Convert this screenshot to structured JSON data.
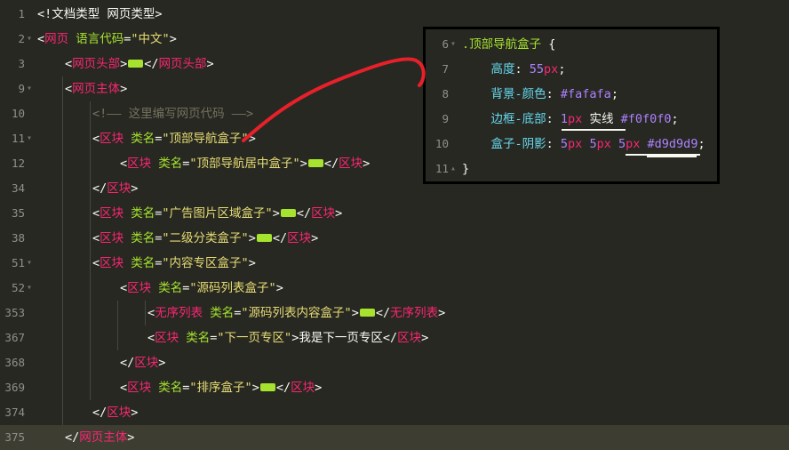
{
  "editor": {
    "lines": [
      {
        "num": "1",
        "fold": "",
        "indent": 0,
        "cur": false,
        "tokens": [
          [
            "p",
            "<!"
          ],
          [
            "p",
            "文档类型 网页类型"
          ],
          [
            "p",
            ">"
          ]
        ]
      },
      {
        "num": "2",
        "fold": "▾",
        "indent": 0,
        "cur": false,
        "tokens": [
          [
            "p",
            "<"
          ],
          [
            "t",
            "网页"
          ],
          [
            "p",
            " "
          ],
          [
            "a",
            "语言代码"
          ],
          [
            "p",
            "="
          ],
          [
            "s",
            "\"中文\""
          ],
          [
            "p",
            ">"
          ]
        ]
      },
      {
        "num": "3",
        "fold": "",
        "indent": 1,
        "cur": false,
        "tokens": [
          [
            "p",
            "<"
          ],
          [
            "t",
            "网页头部"
          ],
          [
            "p",
            ">"
          ],
          [
            "icon",
            "ellipsis-icon"
          ],
          [
            "p",
            "</"
          ],
          [
            "t",
            "网页头部"
          ],
          [
            "p",
            ">"
          ]
        ]
      },
      {
        "num": "9",
        "fold": "▾",
        "indent": 1,
        "cur": false,
        "tokens": [
          [
            "p",
            "<"
          ],
          [
            "t",
            "网页主体"
          ],
          [
            "p",
            ">"
          ]
        ]
      },
      {
        "num": "10",
        "fold": "",
        "indent": 2,
        "cur": false,
        "tokens": [
          [
            "c",
            "<!—— 这里编写网页代码 ——>"
          ]
        ]
      },
      {
        "num": "11",
        "fold": "▾",
        "indent": 2,
        "cur": false,
        "tokens": [
          [
            "p",
            "<"
          ],
          [
            "t",
            "区块"
          ],
          [
            "p",
            " "
          ],
          [
            "a",
            "类名"
          ],
          [
            "p",
            "="
          ],
          [
            "s",
            "\"顶部导航盒子\""
          ],
          [
            "p",
            ">"
          ]
        ]
      },
      {
        "num": "12",
        "fold": "",
        "indent": 3,
        "cur": false,
        "tokens": [
          [
            "p",
            "<"
          ],
          [
            "t",
            "区块"
          ],
          [
            "p",
            " "
          ],
          [
            "a",
            "类名"
          ],
          [
            "p",
            "="
          ],
          [
            "s",
            "\"顶部导航居中盒子\""
          ],
          [
            "p",
            ">"
          ],
          [
            "icon",
            "ellipsis-icon"
          ],
          [
            "p",
            "</"
          ],
          [
            "t",
            "区块"
          ],
          [
            "p",
            ">"
          ]
        ]
      },
      {
        "num": "34",
        "fold": "",
        "indent": 2,
        "cur": false,
        "tokens": [
          [
            "p",
            "</"
          ],
          [
            "t",
            "区块"
          ],
          [
            "p",
            ">"
          ]
        ]
      },
      {
        "num": "35",
        "fold": "",
        "indent": 2,
        "cur": false,
        "tokens": [
          [
            "p",
            "<"
          ],
          [
            "t",
            "区块"
          ],
          [
            "p",
            " "
          ],
          [
            "a",
            "类名"
          ],
          [
            "p",
            "="
          ],
          [
            "s",
            "\"广告图片区域盒子\""
          ],
          [
            "p",
            ">"
          ],
          [
            "icon",
            "ellipsis-icon"
          ],
          [
            "p",
            "</"
          ],
          [
            "t",
            "区块"
          ],
          [
            "p",
            ">"
          ]
        ]
      },
      {
        "num": "38",
        "fold": "",
        "indent": 2,
        "cur": false,
        "tokens": [
          [
            "p",
            "<"
          ],
          [
            "t",
            "区块"
          ],
          [
            "p",
            " "
          ],
          [
            "a",
            "类名"
          ],
          [
            "p",
            "="
          ],
          [
            "s",
            "\"二级分类盒子\""
          ],
          [
            "p",
            ">"
          ],
          [
            "icon",
            "ellipsis-icon"
          ],
          [
            "p",
            "</"
          ],
          [
            "t",
            "区块"
          ],
          [
            "p",
            ">"
          ]
        ]
      },
      {
        "num": "51",
        "fold": "▾",
        "indent": 2,
        "cur": false,
        "tokens": [
          [
            "p",
            "<"
          ],
          [
            "t",
            "区块"
          ],
          [
            "p",
            " "
          ],
          [
            "a",
            "类名"
          ],
          [
            "p",
            "="
          ],
          [
            "s",
            "\"内容专区盒子\""
          ],
          [
            "p",
            ">"
          ]
        ]
      },
      {
        "num": "52",
        "fold": "▾",
        "indent": 3,
        "cur": false,
        "tokens": [
          [
            "p",
            "<"
          ],
          [
            "t",
            "区块"
          ],
          [
            "p",
            " "
          ],
          [
            "a",
            "类名"
          ],
          [
            "p",
            "="
          ],
          [
            "s",
            "\"源码列表盒子\""
          ],
          [
            "p",
            ">"
          ]
        ]
      },
      {
        "num": "353",
        "fold": "",
        "indent": 4,
        "cur": false,
        "tokens": [
          [
            "p",
            "<"
          ],
          [
            "t",
            "无序列表"
          ],
          [
            "p",
            " "
          ],
          [
            "a",
            "类名"
          ],
          [
            "p",
            "="
          ],
          [
            "s",
            "\"源码列表内容盒子\""
          ],
          [
            "p",
            ">"
          ],
          [
            "icon",
            "ellipsis-icon"
          ],
          [
            "p",
            "</"
          ],
          [
            "t",
            "无序列表"
          ],
          [
            "p",
            ">"
          ]
        ]
      },
      {
        "num": "367",
        "fold": "",
        "indent": 4,
        "cur": false,
        "tokens": [
          [
            "p",
            "<"
          ],
          [
            "t",
            "区块"
          ],
          [
            "p",
            " "
          ],
          [
            "a",
            "类名"
          ],
          [
            "p",
            "="
          ],
          [
            "s",
            "\"下一页专区\""
          ],
          [
            "p",
            ">"
          ],
          [
            "w",
            "我是下一页专区"
          ],
          [
            "p",
            "</"
          ],
          [
            "t",
            "区块"
          ],
          [
            "p",
            ">"
          ]
        ]
      },
      {
        "num": "368",
        "fold": "",
        "indent": 3,
        "cur": false,
        "tokens": [
          [
            "p",
            "</"
          ],
          [
            "t",
            "区块"
          ],
          [
            "p",
            ">"
          ]
        ]
      },
      {
        "num": "369",
        "fold": "",
        "indent": 3,
        "cur": false,
        "tokens": [
          [
            "p",
            "<"
          ],
          [
            "t",
            "区块"
          ],
          [
            "p",
            " "
          ],
          [
            "a",
            "类名"
          ],
          [
            "p",
            "="
          ],
          [
            "s",
            "\"排序盒子\""
          ],
          [
            "p",
            ">"
          ],
          [
            "icon",
            "ellipsis-icon"
          ],
          [
            "p",
            "</"
          ],
          [
            "t",
            "区块"
          ],
          [
            "p",
            ">"
          ]
        ]
      },
      {
        "num": "374",
        "fold": "",
        "indent": 2,
        "cur": false,
        "tokens": [
          [
            "p",
            "</"
          ],
          [
            "t",
            "区块"
          ],
          [
            "p",
            ">"
          ]
        ]
      },
      {
        "num": "375",
        "fold": "",
        "indent": 1,
        "cur": true,
        "tokens": [
          [
            "p",
            "</"
          ],
          [
            "t",
            "网页主体"
          ],
          [
            "p",
            ">"
          ]
        ]
      }
    ]
  },
  "css_panel": {
    "lines": [
      {
        "num": "6",
        "fold": "▾",
        "tokens": [
          [
            "a",
            ".顶部导航盒子"
          ],
          [
            "p",
            " {"
          ]
        ]
      },
      {
        "num": "7",
        "fold": "",
        "tokens": [
          [
            "k",
            "    高度"
          ],
          [
            "p",
            ": "
          ],
          [
            "n",
            "55"
          ],
          [
            "t",
            "px"
          ],
          [
            "p",
            ";"
          ]
        ]
      },
      {
        "num": "8",
        "fold": "",
        "tokens": [
          [
            "k",
            "    背景-颜色"
          ],
          [
            "p",
            ": "
          ],
          [
            "n",
            "#fafafa"
          ],
          [
            "p",
            ";"
          ]
        ]
      },
      {
        "num": "9",
        "fold": "",
        "tokens": [
          [
            "k",
            "    边框-底部"
          ],
          [
            "p",
            ": "
          ],
          [
            "n",
            "1"
          ],
          [
            "t",
            "px"
          ],
          [
            "p",
            " "
          ],
          [
            "w",
            "实线"
          ],
          [
            "p",
            " "
          ],
          [
            "n",
            "#f0f0f0"
          ],
          [
            "p",
            ";"
          ]
        ]
      },
      {
        "num": "10",
        "fold": "",
        "tokens": [
          [
            "k",
            "    盒子-阴影"
          ],
          [
            "p",
            ": "
          ],
          [
            "n",
            "5"
          ],
          [
            "t",
            "px"
          ],
          [
            "p",
            " "
          ],
          [
            "n",
            "5"
          ],
          [
            "t",
            "px"
          ],
          [
            "p",
            " "
          ],
          [
            "n",
            "5"
          ],
          [
            "t",
            "px"
          ],
          [
            "p",
            " "
          ],
          [
            "n",
            "#d9d9d9"
          ],
          [
            "p",
            ";"
          ]
        ]
      },
      {
        "num": "11",
        "fold": "▴",
        "tokens": [
          [
            "p",
            "}"
          ]
        ]
      }
    ]
  },
  "colors": {
    "background": "#272822",
    "tag": "#f92672",
    "attribute": "#a6e22e",
    "string": "#e6db74",
    "comment": "#75715e",
    "number": "#ae81ff",
    "property": "#66d9ef",
    "annotation": "#e8202a"
  }
}
